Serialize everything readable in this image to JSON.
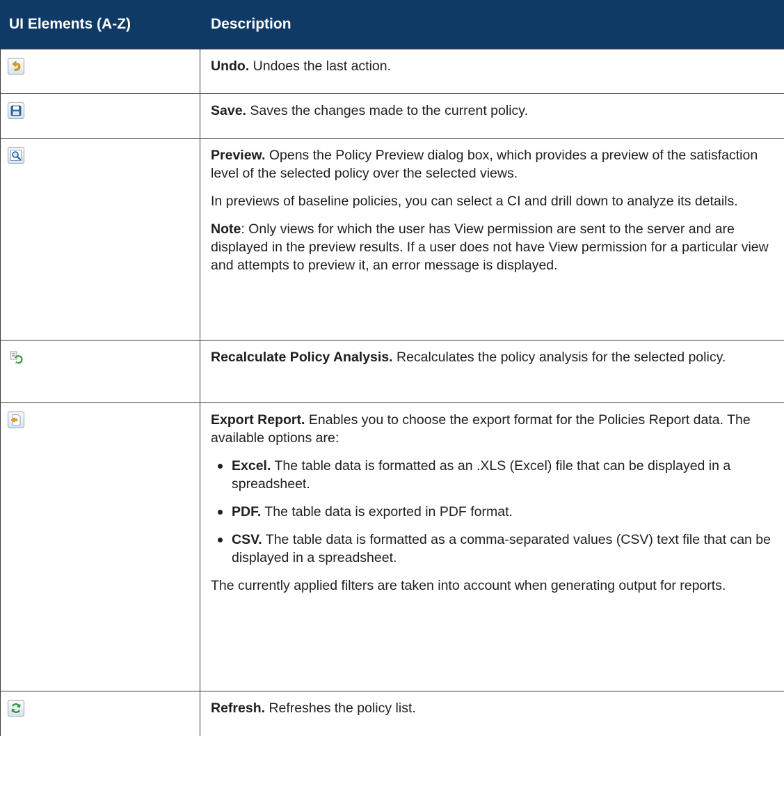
{
  "header": {
    "col1": "UI Elements (A-Z)",
    "col2": "Description"
  },
  "rows": [
    {
      "icon": "undo-icon",
      "title": "Undo.",
      "text": " Undoes the last action."
    },
    {
      "icon": "save-icon",
      "title": "Save.",
      "text": " Saves the changes made to the current policy."
    },
    {
      "icon": "preview-icon",
      "title": "Preview.",
      "text": " Opens the Policy Preview dialog box, which provides a preview of the satisfaction level of the selected policy over the selected views.",
      "para2": "In previews of baseline policies, you can select a CI and drill down to analyze its details.",
      "note_label": "Note",
      "note_text": ": Only views for which the user has View permission are sent to the server and are displayed in the preview results. If a user does not have View permission for a particular view and attempts to preview it, an error message is displayed."
    },
    {
      "icon": "recalculate-icon",
      "title": "Recalculate Policy Analysis.",
      "text": " Recalculates the policy analysis for the selected policy."
    },
    {
      "icon": "export-report-icon",
      "title": "Export Report.",
      "text": " Enables you to choose the export format for the Policies Report data. The available options are:",
      "options": [
        {
          "label": "Excel.",
          "text": " The table data is formatted as an .XLS (Excel) file that can be displayed in a spreadsheet."
        },
        {
          "label": "PDF.",
          "text": " The table data is exported in PDF format."
        },
        {
          "label": "CSV.",
          "text": " The table data is formatted as a comma-separated values (CSV) text file that can be displayed in a spreadsheet."
        }
      ],
      "footer": "The currently applied filters are taken into account when generating output for reports."
    },
    {
      "icon": "refresh-icon",
      "title": "Refresh.",
      "text": " Refreshes the policy list."
    }
  ],
  "colors": {
    "header_bg": "#0f3a66",
    "header_text": "#ffffff",
    "border": "#3b3b3b"
  }
}
